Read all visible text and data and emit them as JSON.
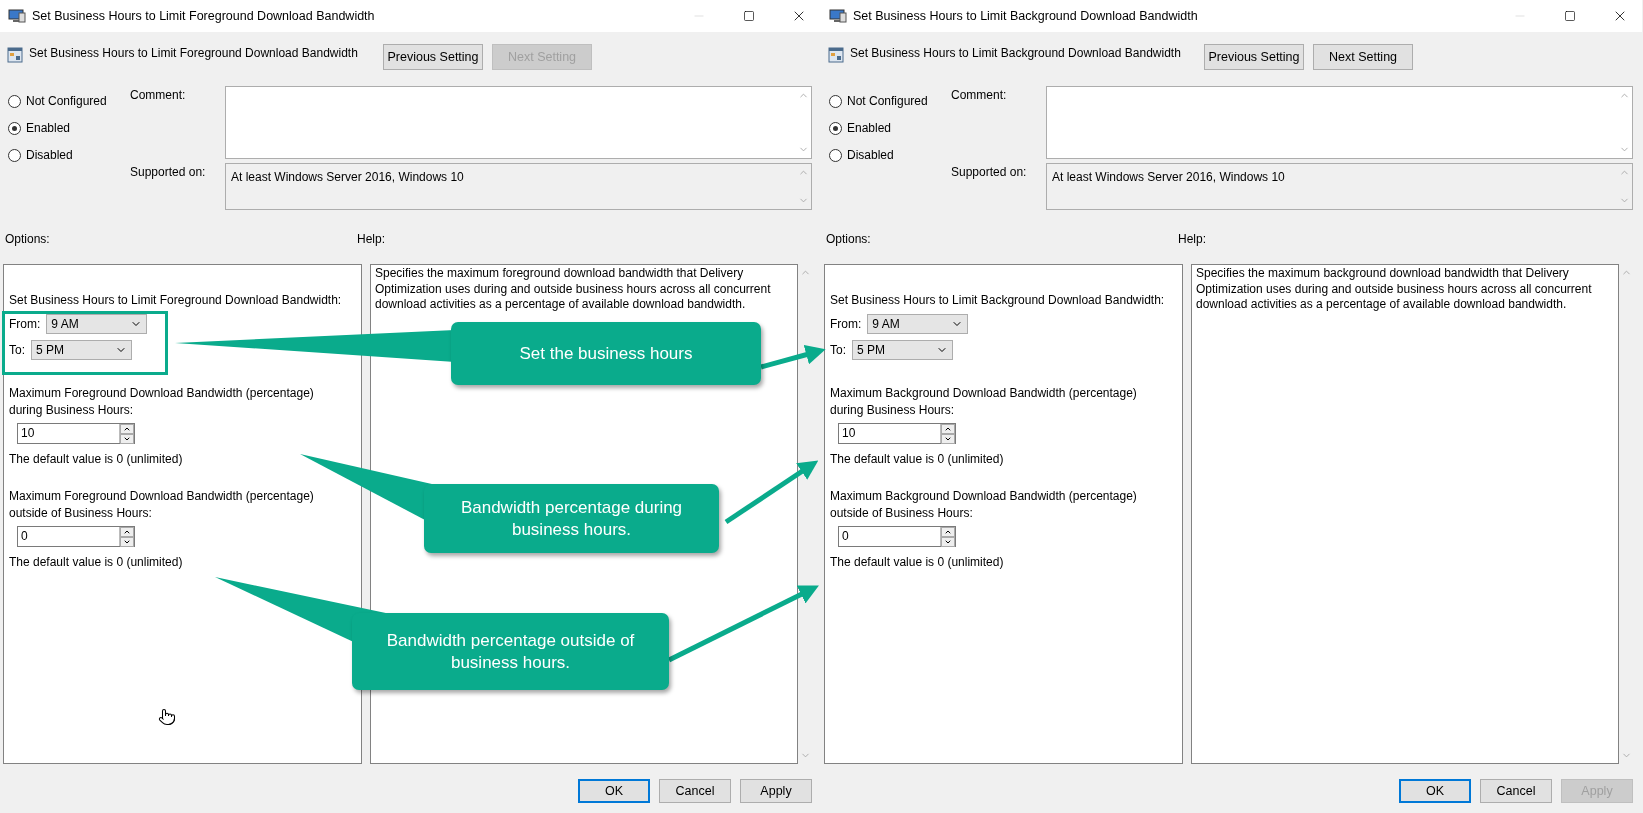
{
  "windows": [
    {
      "title": "Set Business Hours to Limit Foreground Download Bandwidth",
      "heading": "Set Business Hours to Limit Foreground Download Bandwidth",
      "nav_buttons": [
        {
          "label": "Previous Setting",
          "disabled": false
        },
        {
          "label": "Next Setting",
          "disabled": true
        }
      ],
      "radios": [
        {
          "label": "Not Configured",
          "selected": false
        },
        {
          "label": "Enabled",
          "selected": true
        },
        {
          "label": "Disabled",
          "selected": false
        }
      ],
      "comment_label": "Comment:",
      "supported_label": "Supported on:",
      "supported_text": "At least Windows Server 2016, Windows 10",
      "options_label": "Options:",
      "help_label": "Help:",
      "options": {
        "heading": "Set Business Hours to Limit Foreground Download Bandwidth:",
        "from_label": "From:",
        "from_value": "9 AM",
        "to_label": "To:",
        "to_value": "5 PM",
        "fields": [
          {
            "label": "Maximum Foreground Download Bandwidth (percentage) during Business Hours:",
            "value": "10",
            "note": "The default value is 0 (unlimited)"
          },
          {
            "label": "Maximum Foreground Download Bandwidth (percentage) outside of Business Hours:",
            "value": "0",
            "note": "The default value is 0 (unlimited)"
          }
        ]
      },
      "help_text": "Specifies the maximum foreground download bandwidth that Delivery Optimization uses during and outside business hours across all concurrent download activities as a percentage of available download bandwidth.",
      "buttons": [
        {
          "label": "OK",
          "default": true,
          "disabled": false
        },
        {
          "label": "Cancel",
          "default": false,
          "disabled": false
        },
        {
          "label": "Apply",
          "default": false,
          "disabled": false
        }
      ]
    },
    {
      "title": "Set Business Hours to Limit Background Download Bandwidth",
      "heading": "Set Business Hours to Limit Background Download Bandwidth",
      "nav_buttons": [
        {
          "label": "Previous Setting",
          "disabled": false
        },
        {
          "label": "Next Setting",
          "disabled": false
        }
      ],
      "radios": [
        {
          "label": "Not Configured",
          "selected": false
        },
        {
          "label": "Enabled",
          "selected": true
        },
        {
          "label": "Disabled",
          "selected": false
        }
      ],
      "comment_label": "Comment:",
      "supported_label": "Supported on:",
      "supported_text": "At least Windows Server 2016, Windows 10",
      "options_label": "Options:",
      "help_label": "Help:",
      "options": {
        "heading": "Set Business Hours to Limit Background Download Bandwidth:",
        "from_label": "From:",
        "from_value": "9 AM",
        "to_label": "To:",
        "to_value": "5 PM",
        "fields": [
          {
            "label": "Maximum Background Download Bandwidth (percentage) during Business Hours:",
            "value": "10",
            "note": "The default value is 0 (unlimited)"
          },
          {
            "label": "Maximum Background Download Bandwidth (percentage) outside of Business Hours:",
            "value": "0",
            "note": "The default value is 0 (unlimited)"
          }
        ]
      },
      "help_text": "Specifies the maximum background download bandwidth that Delivery Optimization uses during and outside business hours across all concurrent download activities as a percentage of available download bandwidth.",
      "buttons": [
        {
          "label": "OK",
          "default": true,
          "disabled": false
        },
        {
          "label": "Cancel",
          "default": false,
          "disabled": false
        },
        {
          "label": "Apply",
          "default": false,
          "disabled": true
        }
      ]
    }
  ],
  "annotations": [
    {
      "text": "Set the business hours"
    },
    {
      "text": "Bandwidth percentage during business hours."
    },
    {
      "text": "Bandwidth percentage outside of business hours."
    }
  ]
}
